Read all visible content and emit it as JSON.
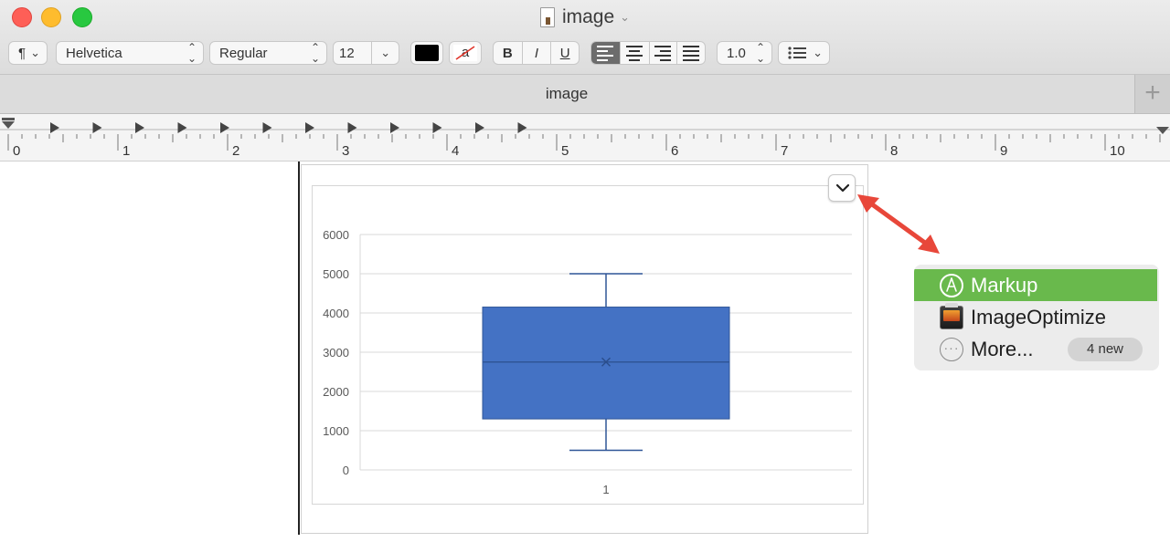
{
  "window": {
    "title": "image",
    "title_chevron_icon": "chevron-down-icon",
    "document_icon": "document-icon"
  },
  "toolbar": {
    "paragraph_style_symbol": "¶",
    "font_family": "Helvetica",
    "font_style": "Regular",
    "font_size": "12",
    "text_color": "#000000",
    "highlight_letter": "a",
    "bold": "B",
    "italic": "I",
    "underline": "U",
    "alignment_selected": "left",
    "line_spacing": "1.0",
    "list_icon": "list-bullets-icon"
  },
  "tab": {
    "title": "image",
    "add_label": "+"
  },
  "ruler": {
    "numbers": [
      "0",
      "1",
      "2",
      "3",
      "4",
      "5",
      "6",
      "7",
      "8",
      "9",
      "10"
    ]
  },
  "chart_data": {
    "type": "box",
    "categories": [
      "1"
    ],
    "y_tick_labels": [
      "0",
      "1000",
      "2000",
      "3000",
      "4000",
      "5000",
      "6000"
    ],
    "ylim": [
      0,
      6000
    ],
    "series": [
      {
        "min": 500,
        "q1": 1300,
        "median": 2750,
        "mean": 2750,
        "q3": 4150,
        "max": 5000
      }
    ],
    "grid": true,
    "colors": {
      "box_fill": "#4472c4",
      "box_stroke": "#2f5597",
      "grid": "#d9d9d9"
    },
    "title": "",
    "xlabel": "",
    "ylabel": ""
  },
  "popup_menu": {
    "items": [
      {
        "label": "Markup",
        "icon": "markup-pen-icon",
        "active": true
      },
      {
        "label": "ImageOptimize",
        "icon": "imageoptimize-app-icon",
        "active": false
      },
      {
        "label": "More...",
        "icon": "more-ellipsis-icon",
        "badge": "4 new",
        "active": false
      }
    ]
  },
  "annotation": {
    "arrow_color": "#e8473a",
    "arrow_icon": "double-headed-arrow"
  }
}
